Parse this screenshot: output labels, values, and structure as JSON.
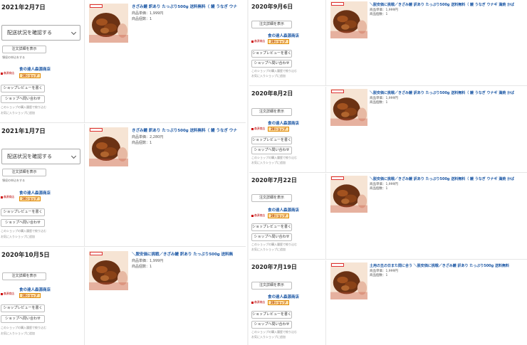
{
  "shop": {
    "name": "食の達人森源商店",
    "logo_text": "森源商店",
    "badge": "20ショップ"
  },
  "labels": {
    "delivery_status": "配送状況を確認する",
    "order_detail": "注文詳細を表示",
    "receipt": "領収の申込をする",
    "review": "ショップレビューを書く",
    "inquiry": "ショップへ問い合わせ",
    "history_note": "このショップの購入履歴で絞り込む",
    "favorite_note": "お気に入りショップに追加",
    "price_label": "商品単価：",
    "qty_label": "商品個数："
  },
  "orders_left": [
    {
      "date": "2021年2月7日",
      "title": "きざみ鰻 訳あり たっぷり500g 送料無料（ 鰻 うなぎ ウナ",
      "price": "1,999円",
      "qty": "1",
      "has_delivery": true,
      "has_receipt": true
    },
    {
      "date": "2021年1月7日",
      "title": "きざみ鰻 訳あり たっぷり500g 送料無料（ 鰻 うなぎ ウナ",
      "price": "2,280円",
      "qty": "1",
      "has_delivery": true,
      "has_receipt": true
    },
    {
      "date": "2020年10月5日",
      "title": "＼脱安価に挑戦／きざみ鰻 訳あり たっぷり500g 送料無",
      "price": "1,999円",
      "qty": "1",
      "has_delivery": false,
      "has_receipt": false
    }
  ],
  "orders_right": [
    {
      "date": "2020年9月6日",
      "title": "＼脱安価に挑戦／きざみ鰻 訳あり たっぷり500g 送料無料（ 鰻 うなぎ ウナギ 満焼 かば",
      "price": "1,999円",
      "qty": "1"
    },
    {
      "date": "2020年8月2日",
      "title": "＼脱安価に挑戦／きざみ鰻 訳あり たっぷり500g 送料無料（ 鰻 うなぎ ウナギ 満焼 かば",
      "price": "1,999円",
      "qty": "1"
    },
    {
      "date": "2020年7月22日",
      "title": "＼脱安価に挑戦／きざみ鰻 訳あり たっぷり500g 送料無料（ 鰻 うなぎ ウナギ 満焼 かば",
      "price": "1,999円",
      "qty": "1"
    },
    {
      "date": "2020年7月19日",
      "title": "土用の丑の日また間に合う ＼脱安価に挑戦／きざみ鰻 訳あり たっぷり500g 送料無料",
      "price": "1,999円",
      "qty": "1"
    }
  ],
  "colors": {
    "link": "#1a56a4",
    "badge_bg": "#ffe2a8",
    "badge_border": "#e08a00"
  }
}
